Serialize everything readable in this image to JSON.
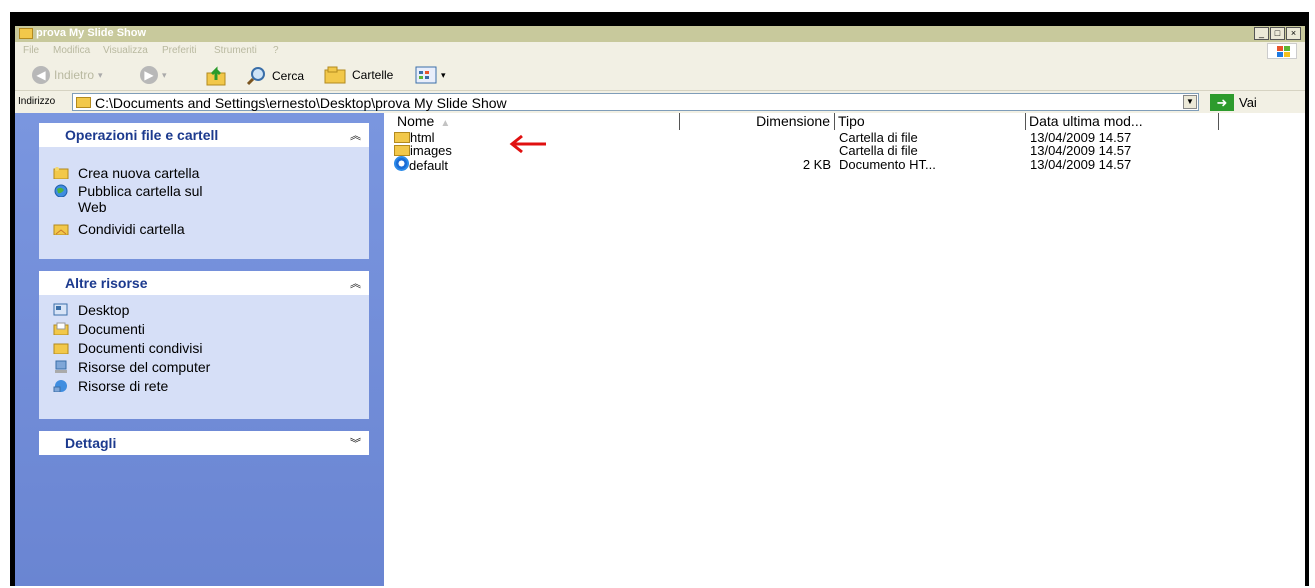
{
  "window": {
    "title": "prova My Slide Show",
    "controls": [
      "_",
      "□",
      "×"
    ]
  },
  "menu": [
    "File",
    "Modifica",
    "Visualizza",
    "Preferiti",
    "Strumenti",
    "?"
  ],
  "toolbar": {
    "back_label": "Indietro",
    "search_label": "Cerca",
    "folders_label": "Cartelle"
  },
  "address": {
    "label": "Indirizzo",
    "path": "C:\\Documents and Settings\\ernesto\\Desktop\\prova My Slide Show",
    "go_label": "Vai"
  },
  "taskpane": {
    "file_ops": {
      "title": "Operazioni file e cartell",
      "items": [
        {
          "label": "Crea nuova cartella",
          "icon": "new-folder-icon"
        },
        {
          "label": "Pubblica cartella sul",
          "label2": "Web",
          "icon": "publish-web-icon"
        },
        {
          "label": "Condividi cartella",
          "icon": "share-folder-icon"
        }
      ]
    },
    "other": {
      "title": "Altre risorse",
      "items": [
        {
          "label": "Desktop",
          "icon": "desktop-icon"
        },
        {
          "label": "Documenti",
          "icon": "documents-icon"
        },
        {
          "label": "Documenti condivisi",
          "icon": "shared-documents-icon"
        },
        {
          "label": "Risorse del computer",
          "icon": "computer-icon"
        },
        {
          "label": "Risorse di rete",
          "icon": "network-icon"
        }
      ]
    },
    "details": {
      "title": "Dettagli"
    }
  },
  "files": {
    "columns": [
      "Nome",
      "Dimensione",
      "Tipo",
      "Data ultima mod..."
    ],
    "rows": [
      {
        "name": "html",
        "size": "",
        "type": "Cartella di file",
        "date": "13/04/2009 14.57",
        "icon": "folder-icon"
      },
      {
        "name": "images",
        "size": "",
        "type": "Cartella di file",
        "date": "13/04/2009 14.57",
        "icon": "folder-icon"
      },
      {
        "name": "default",
        "size": "2 KB",
        "type": "Documento HT...",
        "date": "13/04/2009 14.57",
        "icon": "internet-explorer-icon"
      }
    ]
  },
  "colors": {
    "taskpane_bg": "#7a96df",
    "pane_head_text": "#1c3a8e",
    "annotation_arrow": "#e01010"
  }
}
